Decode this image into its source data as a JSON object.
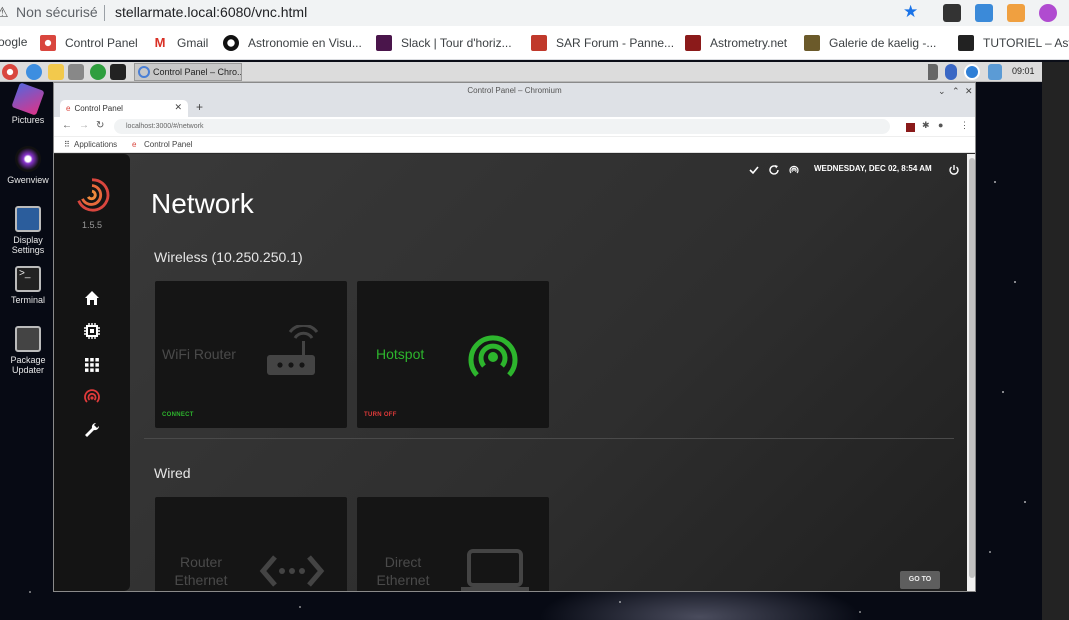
{
  "host_browser": {
    "security": "Non sécurisé",
    "url": "stellarmate.local:6080/vnc.html",
    "bookmarks": [
      {
        "label": "oogle"
      },
      {
        "label": "Control Panel"
      },
      {
        "label": "Gmail"
      },
      {
        "label": "Astronomie en Visu..."
      },
      {
        "label": "Slack | Tour d'horiz..."
      },
      {
        "label": "SAR Forum - Panne..."
      },
      {
        "label": "Astrometry.net"
      },
      {
        "label": "Galerie de kaelig -..."
      },
      {
        "label": "TUTORIEL – Astr"
      }
    ]
  },
  "taskbar": {
    "task_label": "Control Panel – Chro...",
    "clock": "09:01"
  },
  "desktop_icons": [
    {
      "label": "Pictures"
    },
    {
      "label": "Gwenview"
    },
    {
      "label": "Display Settings"
    },
    {
      "label": "Terminal"
    },
    {
      "label": "Package Updater"
    }
  ],
  "inner_browser": {
    "window_title": "Control Panel – Chromium",
    "tab_title": "Control Panel",
    "url": "localhost:3000/#/network",
    "bookmarks": {
      "apps": "Applications",
      "cp": "Control Panel"
    }
  },
  "app": {
    "version": "1.5.5",
    "date": "WEDNESDAY, DEC 02, 8:54 AM",
    "page_title": "Network",
    "wireless_title": "Wireless (10.250.250.1)",
    "wired_title": "Wired",
    "cards": {
      "wifi": {
        "label": "WiFi Router",
        "action": "CONNECT"
      },
      "hotspot": {
        "label": "Hotspot",
        "action": "TURN OFF"
      },
      "router_eth": {
        "label": "Router Ethernet"
      },
      "direct_eth": {
        "label": "Direct Ethernet"
      }
    },
    "goto": "GO TO",
    "colors": {
      "green": "#2db52d",
      "red": "#e03a3a",
      "accent": "#d9463e"
    }
  }
}
